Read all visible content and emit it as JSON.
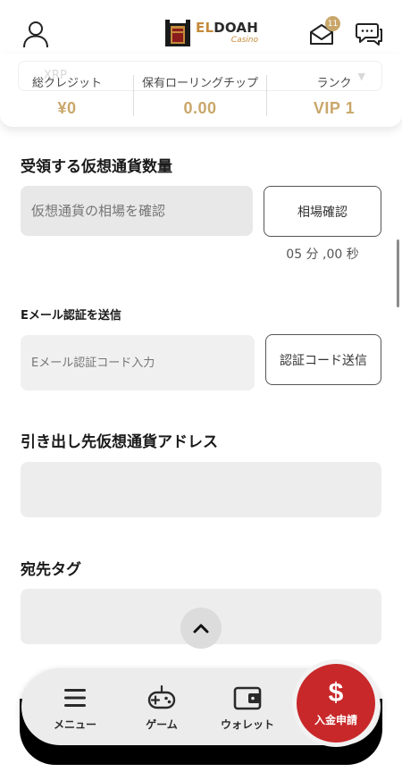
{
  "header": {
    "logo_main_prefix": "EL",
    "logo_main_suffix": "DOAH",
    "logo_sub": "Casino",
    "mail_badge_count": "11"
  },
  "stats": {
    "ghost_text": "XRP",
    "items": [
      {
        "label": "総クレジット",
        "value": "¥0"
      },
      {
        "label": "保有ローリングチップ",
        "value": "0.00"
      },
      {
        "label": "ランク",
        "value": "VIP 1"
      }
    ]
  },
  "form": {
    "crypto_amount": {
      "title": "受領する仮想通貨数量",
      "placeholder": "仮想通貨の相場を確認",
      "button": "相場確認",
      "timer": "05 分 ,00 秒"
    },
    "email_auth": {
      "title": "Eメール認証を送信",
      "placeholder": "Eメール認証コード入力",
      "button": "認証コード送信"
    },
    "withdraw_address": {
      "title": "引き出し先仮想通貨アドレス",
      "value": ""
    },
    "dest_tag": {
      "title": "宛先タグ",
      "value": ""
    }
  },
  "bottom_nav": {
    "items": [
      {
        "label": "メニュー",
        "icon": "hamburger-menu-icon"
      },
      {
        "label": "ゲーム",
        "icon": "gamepad-icon"
      },
      {
        "label": "ウォレット",
        "icon": "wallet-icon"
      }
    ],
    "deposit": {
      "symbol": "$",
      "label": "入金申請"
    }
  },
  "colors": {
    "accent_gold": "#c9a76a",
    "deposit_red": "#c8282a",
    "input_gray": "#e8e8e8",
    "nav_bg": "#ececec"
  }
}
